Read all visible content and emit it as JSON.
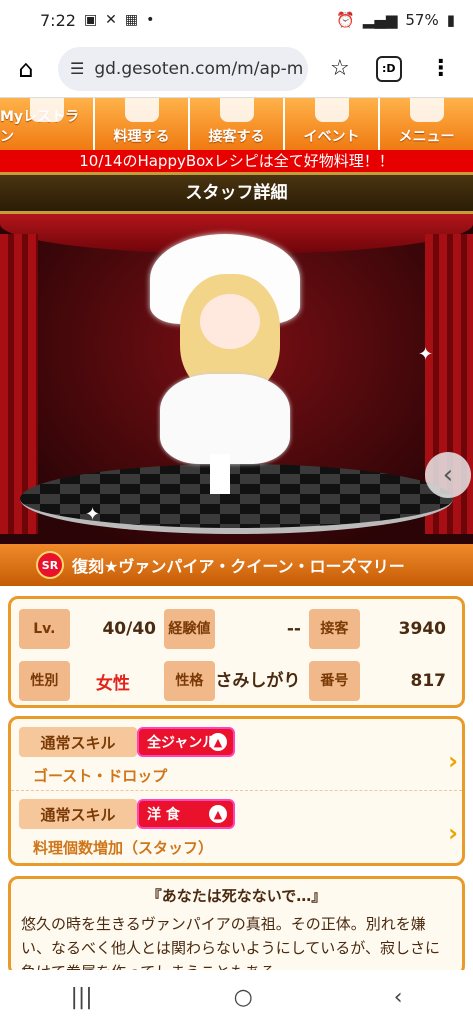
{
  "status": {
    "time": "7:22",
    "left_icons": [
      "image-icon",
      "x-icon",
      "calendar-icon"
    ],
    "dot": "•",
    "battery": "57%"
  },
  "browser": {
    "url": "gd.gesoten.com/m/ap-m",
    "tabs_label": ":D"
  },
  "nav": {
    "items": [
      {
        "label": "Myレストラン"
      },
      {
        "label": "料理する"
      },
      {
        "label": "接客する"
      },
      {
        "label": "イベント"
      },
      {
        "label": "メニュー"
      }
    ]
  },
  "ticker": "10/14のHappyBoxレシピは全て好物料理！！",
  "page_title": "スタッフ詳細",
  "staff": {
    "rarity": "SR",
    "name": "復刻★ヴァンパイア・クイーン・ローズマリー"
  },
  "stats": {
    "lv_label": "Lv.",
    "lv_value": "40/40",
    "exp_label": "経験値",
    "exp_value": "--",
    "service_label": "接客",
    "service_value": "3940",
    "gender_label": "性別",
    "gender_value": "女性",
    "personality_label": "性格",
    "personality_value": "さみしがり",
    "number_label": "番号",
    "number_value": "817"
  },
  "skills": [
    {
      "type": "通常スキル",
      "genre": "全ジャンル",
      "name": "ゴースト・ドロップ"
    },
    {
      "type": "通常スキル",
      "genre": "洋 食",
      "name": "料理個数増加（スタッフ）"
    }
  ],
  "description": {
    "title": "『あなたは死なないで…』",
    "text": "悠久の時を生きるヴァンパイアの真祖。その正体。別れを嫌い、なるべく他人とは関わらないようにしているが、寂しさに負けて眷属を作ってしまうこともある。"
  }
}
